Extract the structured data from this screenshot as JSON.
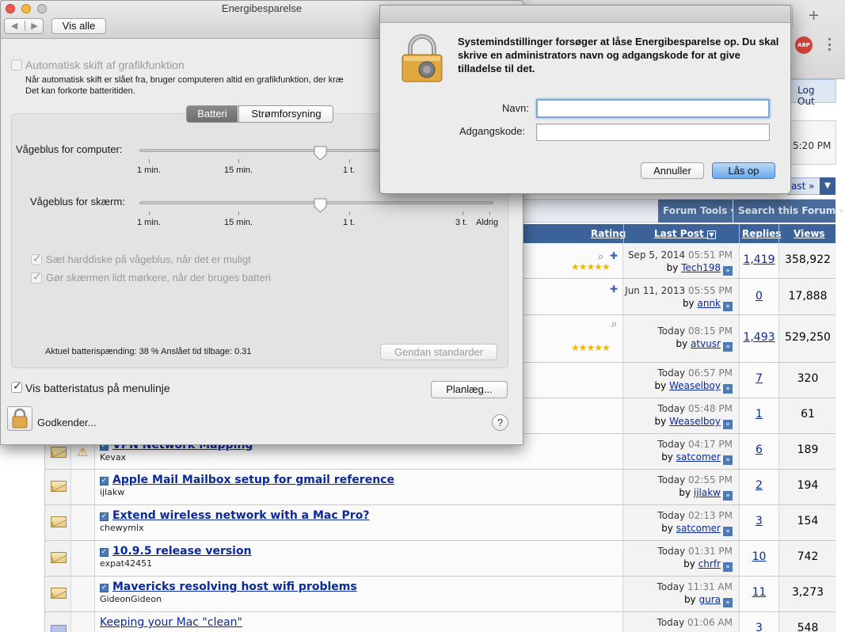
{
  "browser": {
    "new_tab_label": "+",
    "adblock_badge": "ABP",
    "logout_text": "Log Out",
    "time_text": "5:20 PM",
    "pager_text": "ast »"
  },
  "forum": {
    "tools": [
      "Forum Tools",
      "Search this Forum"
    ],
    "columns": {
      "rating": "Rating",
      "last_post": "Last Post",
      "replies": "Replies",
      "views": "Views"
    },
    "rows": [
      {
        "title": "",
        "starter": "",
        "date": "Sep 5, 2014",
        "time": "05:51 PM",
        "by": "Tech198",
        "replies": "1,419",
        "views": "358,922",
        "stars": "★★★★★",
        "attach": true,
        "pin": true
      },
      {
        "title": "",
        "starter": "",
        "date": "Jun 11, 2013",
        "time": "05:55 PM",
        "by": "annk",
        "replies": "0",
        "views": "17,888",
        "stars": "",
        "attach": false,
        "pin": true
      },
      {
        "title": "",
        "starter": "",
        "date": "Today",
        "time": "08:15 PM",
        "by": "atvusr",
        "replies": "1,493",
        "views": "529,250",
        "stars": "★★★★★",
        "attach": true,
        "pin": false
      },
      {
        "title": "",
        "starter": "",
        "date": "Today",
        "time": "06:57 PM",
        "by": "Weaselboy",
        "replies": "7",
        "views": "320",
        "stars": "",
        "attach": false,
        "pin": false
      },
      {
        "title": "",
        "starter": "",
        "date": "Today",
        "time": "05:48 PM",
        "by": "Weaselboy",
        "replies": "1",
        "views": "61",
        "stars": "",
        "attach": false,
        "pin": false
      },
      {
        "title": "VPN Network Mapping",
        "starter": "Kevax",
        "date": "Today",
        "time": "04:17 PM",
        "by": "satcomer",
        "replies": "6",
        "views": "189",
        "stars": "",
        "attach": false,
        "pin": false,
        "warn": true
      },
      {
        "title": "Apple Mail Mailbox setup for gmail reference",
        "starter": "ijlakw",
        "date": "Today",
        "time": "02:55 PM",
        "by": "ijlakw",
        "replies": "2",
        "views": "194"
      },
      {
        "title": "Extend wireless network with a Mac Pro?",
        "starter": "chewymix",
        "date": "Today",
        "time": "02:13 PM",
        "by": "satcomer",
        "replies": "3",
        "views": "154"
      },
      {
        "title": "10.9.5 release version",
        "starter": "expat42451",
        "date": "Today",
        "time": "01:31 PM",
        "by": "chrfr",
        "replies": "10",
        "views": "742"
      },
      {
        "title": "Mavericks resolving host wifi problems",
        "starter": "GideonGideon",
        "date": "Today",
        "time": "11:31 AM",
        "by": "gura",
        "replies": "11",
        "views": "3,273"
      },
      {
        "title": "Keeping your Mac \"clean\"",
        "starter": "",
        "date": "Today",
        "time": "01:06 AM",
        "by": "",
        "replies": "3",
        "views": "548"
      }
    ]
  },
  "energy": {
    "title": "Energibesparelse",
    "show_all": "Vis alle",
    "auto_switch_label": "Automatisk skift af grafikfunktion",
    "auto_switch_desc_1": "Når automatisk skift er slået fra, bruger computeren altid en grafikfunktion, der kræ",
    "auto_switch_desc_2": "Det kan forkorte batteritiden.",
    "tab_battery": "Batteri",
    "tab_power": "Strømforsyning",
    "computer_sleep_label": "Vågeblus for computer:",
    "display_sleep_label": "Vågeblus for skærm:",
    "computer_sleep_value": 0.51,
    "display_sleep_value": 0.51,
    "ticks_computer": [
      "1 min.",
      "15 min.",
      "1 t."
    ],
    "ticks_display": [
      "1 min.",
      "15 min.",
      "1 t.",
      "3 t.",
      "Aldrig"
    ],
    "hdd_label": "Sæt harddiske på vågeblus, når det er muligt",
    "dim_label": "Gør skærmen lidt mørkere, når der bruges batteri",
    "battery_status": "Aktuel batterispænding: 38 %  Anslået tid tilbage: 0.31",
    "restore_defaults": "Gendan standarder",
    "menu_status_label": "Vis batteristatus på menulinje",
    "schedule": "Planlæg...",
    "authorize": "Godkender...",
    "help": "?"
  },
  "auth": {
    "message": "Systemindstillinger forsøger at låse Energibesparelse op. Du skal skrive en administrators navn og adgangskode for at give tilladelse til det.",
    "name_label": "Navn:",
    "name_value": "",
    "password_label": "Adgangskode:",
    "password_value": "",
    "cancel": "Annuller",
    "unlock": "Lås op"
  },
  "colors": {
    "header_blue": "#3b639a",
    "link": "#0b2a9a",
    "primary_button": "#6aa7ea"
  }
}
